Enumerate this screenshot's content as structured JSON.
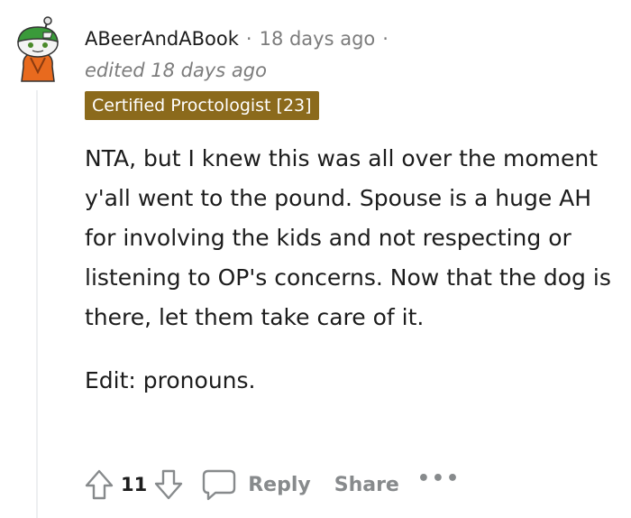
{
  "comment": {
    "username": "ABeerAndABook",
    "separator": "·",
    "timestamp": "18 days ago",
    "edited": "edited 18 days ago",
    "flair": "Certified Proctologist [23]",
    "body": [
      "NTA, but I knew this was all over the moment y'all went to the pound. Spouse is a huge AH for involving the kids and not respecting or listening to OP's concerns. Now that the dog is there, let them take care of it."
    ],
    "edit_note": "Edit: pronouns.",
    "score": "11",
    "actions": {
      "reply": "Reply",
      "share": "Share",
      "more": "•••"
    }
  },
  "colors": {
    "flair_bg": "#8b6a1c",
    "muted": "#7c7c7c",
    "text": "#1c1c1c",
    "action": "#878a8c"
  },
  "icons": {
    "avatar": "snoo-avatar",
    "upvote": "upvote-arrow-icon",
    "downvote": "downvote-arrow-icon",
    "reply": "speech-bubble-icon"
  }
}
